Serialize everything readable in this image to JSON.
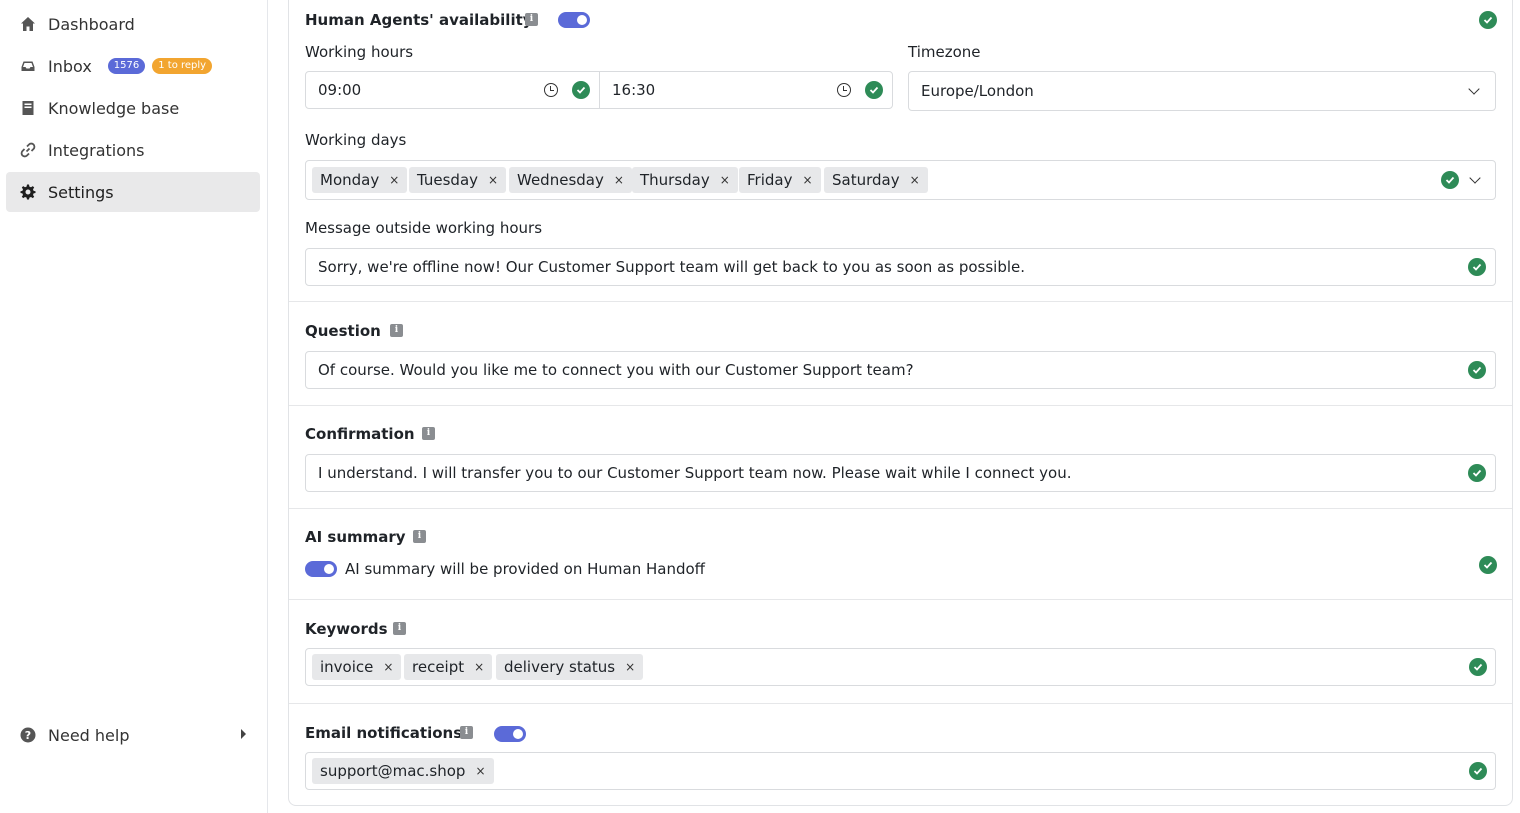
{
  "sidebar": {
    "items": [
      {
        "label": "Dashboard",
        "icon": "home-icon"
      },
      {
        "label": "Inbox",
        "icon": "inbox-icon",
        "count": "1576",
        "reply": "1 to reply"
      },
      {
        "label": "Knowledge base",
        "icon": "book-icon"
      },
      {
        "label": "Integrations",
        "icon": "link-icon"
      },
      {
        "label": "Settings",
        "icon": "gear-icon",
        "active": true
      }
    ],
    "help": {
      "label": "Need help",
      "icon": "question-icon"
    }
  },
  "availability": {
    "title": "Human Agents' availability",
    "enabled": true,
    "working_hours_label": "Working hours",
    "start_time": "09:00",
    "end_time": "16:30",
    "timezone_label": "Timezone",
    "timezone": "Europe/London",
    "working_days_label": "Working days",
    "days": [
      "Monday",
      "Tuesday",
      "Wednesday",
      "Thursday",
      "Friday",
      "Saturday"
    ],
    "outside_label": "Message outside working hours",
    "outside_message": "Sorry, we're offline now! Our Customer Support team will get back to you as soon as possible."
  },
  "question": {
    "title": "Question",
    "value": "Of course. Would you like me to connect you with our Customer Support team?"
  },
  "confirmation": {
    "title": "Confirmation",
    "value": "I understand. I will transfer you to our Customer Support team now. Please wait while I connect you."
  },
  "ai_summary": {
    "title": "AI summary",
    "enabled": true,
    "toggle_label": "AI summary will be provided on Human Handoff"
  },
  "keywords": {
    "title": "Keywords",
    "items": [
      "invoice",
      "receipt",
      "delivery status"
    ]
  },
  "email_notifications": {
    "title": "Email notifications",
    "enabled": true,
    "items": [
      "support@mac.shop"
    ]
  },
  "colors": {
    "accent": "#5b6ad8",
    "success": "#2e8b57",
    "badge_reply": "#f2a530"
  }
}
